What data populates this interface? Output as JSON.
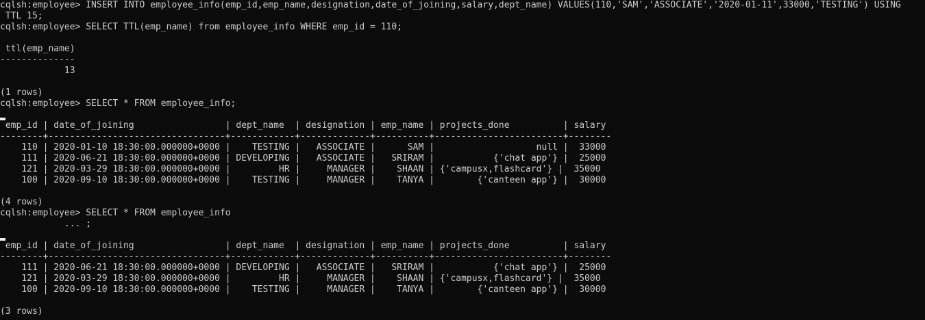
{
  "terminal": {
    "lines": [
      {
        "text": "cqlsh:employee> INSERT INTO employee_info(emp_id,emp_name,designation,date_of_joining,salary,dept_name) VALUES(110,'SAM','ASSOCIATE','2020-01-11',33000,'TESTING') USING",
        "kind": "prompt"
      },
      {
        "text": " TTL 15;",
        "kind": "prompt"
      },
      {
        "text": "cqlsh:employee> SELECT TTL(emp_name) from employee_info WHERE emp_id = 110;",
        "kind": "prompt"
      },
      {
        "text": "",
        "kind": "blank"
      },
      {
        "text": " ttl(emp_name)",
        "kind": "header"
      },
      {
        "text": "--------------",
        "kind": "sep"
      },
      {
        "text": "            13",
        "kind": "row"
      },
      {
        "text": "",
        "kind": "blank"
      },
      {
        "text": "(1 rows)",
        "kind": "status"
      },
      {
        "text": "cqlsh:employee> SELECT * FROM employee_info;",
        "kind": "prompt"
      },
      {
        "text": "",
        "kind": "cursor"
      },
      {
        "text": " emp_id | date_of_joining                 | dept_name  | designation | emp_name | projects_done          | salary",
        "kind": "header"
      },
      {
        "text": "--------+---------------------------------+------------+-------------+----------+------------------------+--------",
        "kind": "sep"
      },
      {
        "text": "    110 | 2020-01-10 18:30:00.000000+0000 |    TESTING |   ASSOCIATE |      SAM |                   null |  33000",
        "kind": "row"
      },
      {
        "text": "    111 | 2020-06-21 18:30:00.000000+0000 | DEVELOPING |   ASSOCIATE |   SRIRAM |           {'chat app'} |  25000",
        "kind": "row"
      },
      {
        "text": "    121 | 2020-03-29 18:30:00.000000+0000 |         HR |     MANAGER |    SHAAN | {'campusx,flashcard'} |  35000",
        "kind": "row"
      },
      {
        "text": "    100 | 2020-09-10 18:30:00.000000+0000 |    TESTING |     MANAGER |    TANYA |        {'canteen app'} |  30000",
        "kind": "row"
      },
      {
        "text": "",
        "kind": "blank"
      },
      {
        "text": "(4 rows)",
        "kind": "status"
      },
      {
        "text": "cqlsh:employee> SELECT * FROM employee_info",
        "kind": "prompt"
      },
      {
        "text": "            ... ;",
        "kind": "prompt"
      },
      {
        "text": "",
        "kind": "cursor"
      },
      {
        "text": " emp_id | date_of_joining                 | dept_name  | designation | emp_name | projects_done          | salary",
        "kind": "header"
      },
      {
        "text": "--------+---------------------------------+------------+-------------+----------+------------------------+--------",
        "kind": "sep"
      },
      {
        "text": "    111 | 2020-06-21 18:30:00.000000+0000 | DEVELOPING |   ASSOCIATE |   SRIRAM |           {'chat app'} |  25000",
        "kind": "row"
      },
      {
        "text": "    121 | 2020-03-29 18:30:00.000000+0000 |         HR |     MANAGER |    SHAAN | {'campusx,flashcard'} |  35000",
        "kind": "row"
      },
      {
        "text": "    100 | 2020-09-10 18:30:00.000000+0000 |    TESTING |     MANAGER |    TANYA |        {'canteen app'} |  30000",
        "kind": "row"
      },
      {
        "text": "",
        "kind": "blank"
      },
      {
        "text": "(3 rows)",
        "kind": "status"
      }
    ],
    "colors": {
      "background": "#0c0c0c",
      "text": "#cccccc"
    }
  }
}
